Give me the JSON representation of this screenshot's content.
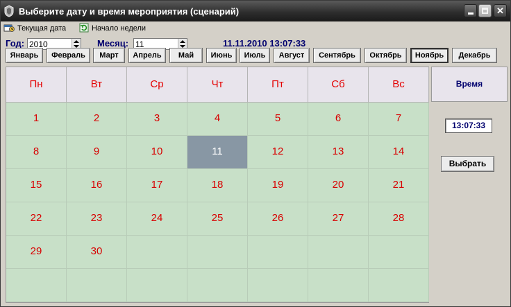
{
  "window": {
    "title": "Выберите дату и время мероприятия (сценарий)"
  },
  "toolbar": {
    "current_date": "Текущая дата",
    "week_start": "Начало недели"
  },
  "controls": {
    "year_label": "Год:",
    "year_value": "2010",
    "month_label": "Месяц:",
    "month_value": "11",
    "datetime": "11.11.2010 13:07:33"
  },
  "months": [
    "Январь",
    "Февраль",
    "Март",
    "Апрель",
    "Май",
    "Июнь",
    "Июль",
    "Август",
    "Сентябрь",
    "Октябрь",
    "Ноябрь",
    "Декабрь"
  ],
  "active_month": "Ноябрь",
  "weekdays": [
    "Пн",
    "Вт",
    "Ср",
    "Чт",
    "Пт",
    "Сб",
    "Вс"
  ],
  "weeks": [
    [
      "1",
      "2",
      "3",
      "4",
      "5",
      "6",
      "7"
    ],
    [
      "8",
      "9",
      "10",
      "11",
      "12",
      "13",
      "14"
    ],
    [
      "15",
      "16",
      "17",
      "18",
      "19",
      "20",
      "21"
    ],
    [
      "22",
      "23",
      "24",
      "25",
      "26",
      "27",
      "28"
    ],
    [
      "29",
      "30",
      "",
      "",
      "",
      "",
      ""
    ],
    [
      "",
      "",
      "",
      "",
      "",
      "",
      ""
    ]
  ],
  "selected_day": "11",
  "time_panel": {
    "header": "Время",
    "time_value": "13:07:33",
    "choose_label": "Выбрать"
  },
  "colors": {
    "calendar_bg": "#c8e0c8",
    "header_bg": "#e8e4ec",
    "day_text": "#d80000",
    "selected_bg": "#8897a4",
    "label_text": "#00006e"
  }
}
